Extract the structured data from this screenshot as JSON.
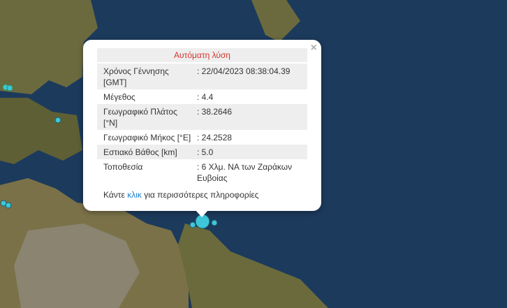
{
  "colors": {
    "sea": "#1c3a5c",
    "land": "#6b6a3e",
    "marker": "#3ec6d8"
  },
  "popup": {
    "title": "Αυτόματη λύση",
    "close_icon": "close-icon",
    "rows": [
      {
        "label": "Χρόνος Γέννησης [GMT]",
        "value": ": 22/04/2023 08:38:04.39"
      },
      {
        "label": "Μέγεθος",
        "value": ": 4.4"
      },
      {
        "label": "Γεωγραφικό Πλάτος [°N]",
        "value": ": 38.2646"
      },
      {
        "label": "Γεωγραφικό Μήκος [°E]",
        "value": ": 24.2528"
      },
      {
        "label": "Εστιακό Βάθος [km]",
        "value": ": 5.0"
      },
      {
        "label": "Τοποθεσία",
        "value": ": 6 Χλμ. ΝΑ των Ζαράκων Ευβοίας"
      }
    ],
    "footer": {
      "before": "Κάντε ",
      "link": "κλικ",
      "after": " για περισσότερες πληροφορίες"
    }
  }
}
